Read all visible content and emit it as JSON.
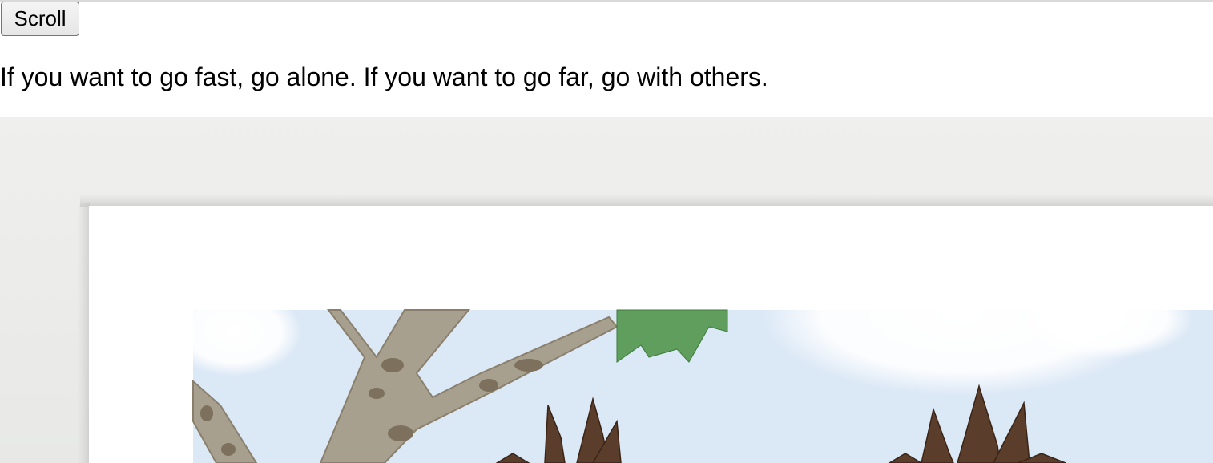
{
  "toolbar": {
    "scroll_label": "Scroll"
  },
  "content": {
    "quote": "If you want to go fast, go alone. If you want to go far, go with others."
  },
  "image": {
    "name": "illustration",
    "background_color": "#ececec",
    "mat_color": "#ffffff",
    "sky_color": "#dbe8f6"
  }
}
